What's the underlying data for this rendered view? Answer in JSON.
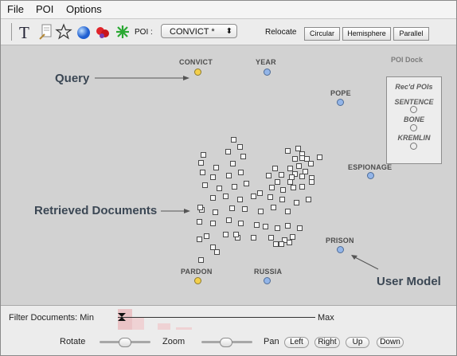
{
  "menubar": {
    "items": [
      "File",
      "POI",
      "Options"
    ]
  },
  "toolbar": {
    "icons": [
      "text-tool-icon",
      "search-tool-icon",
      "star-tool-icon",
      "blue-sphere-icon",
      "red-cluster-icon",
      "green-star-icon"
    ],
    "poi_label": "POI :",
    "poi_selected": "CONVICT *",
    "relocate_label": "Relocate",
    "relocate_buttons": [
      "Circular",
      "Hemisphere",
      "Parallel"
    ]
  },
  "canvas": {
    "pois": {
      "convict": "CONVICT",
      "year": "YEAR",
      "pope": "POPE",
      "espionage": "ESPIONAGE",
      "prison": "PRISON",
      "russia": "RUSSIA",
      "pardon": "PARDON"
    },
    "annotations": {
      "query": "Query",
      "retrieved": "Retrieved Documents",
      "user_model": "User Model"
    },
    "dock": {
      "title": "POI Dock",
      "subtitle": "Rec'd POIs",
      "terms": [
        "SENTENCE",
        "BONE",
        "KREMLIN"
      ]
    }
  },
  "controls": {
    "filter_label": "Filter Documents: Min",
    "filter_max": "Max",
    "rotate_label": "Rotate",
    "zoom_label": "Zoom",
    "pan_label": "Pan",
    "pan_buttons": [
      "Left",
      "Right",
      "Up",
      "Down"
    ]
  },
  "colors": {
    "query_poi": "#f3cf4b",
    "user_poi": "#93b5e8",
    "canvas_bg": "#d2d2d2"
  }
}
